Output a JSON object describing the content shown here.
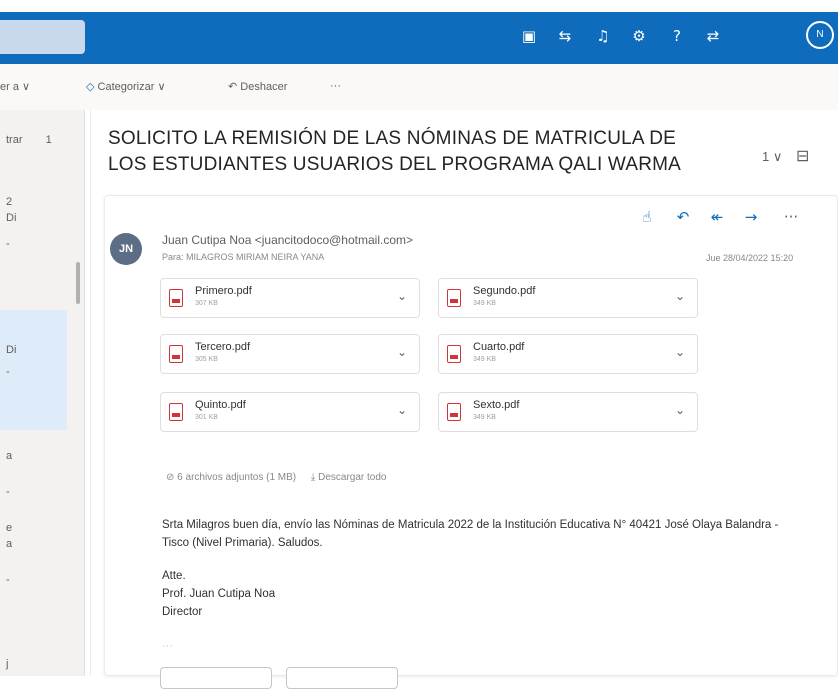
{
  "topbar": {
    "icons": [
      "outlook-icon",
      "teams-icon",
      "bell-icon",
      "gear-icon",
      "help-icon",
      "feedback-icon"
    ],
    "avatar_initials": "N"
  },
  "command_bar": {
    "move_label": "er a",
    "categorize_label": "Categorizar",
    "undo_label": "Deshacer",
    "more_label": "···"
  },
  "left_list": {
    "filter_label": "trar",
    "filter_count": "1",
    "items": [
      "2",
      "Di",
      "-",
      "Di",
      "-",
      "a",
      "-",
      "e",
      "a",
      "-",
      "j"
    ]
  },
  "message": {
    "subject": "SOLICITO LA REMISIÓN DE LAS NÓMINAS DE MATRICULA DE LOS ESTUDIANTES USUARIOS DEL PROGRAMA QALI WARMA",
    "subject_actions": "1 ∨",
    "sender_initials": "JN",
    "from": "Juan Cutipa Noa <juancitodoco@hotmail.com>",
    "to": "Para: MILAGROS MIRIAM NEIRA YANA",
    "date": "Jue 28/04/2022 15:20",
    "attachments": [
      {
        "name": "Primero.pdf",
        "size": "307 KB"
      },
      {
        "name": "Segundo.pdf",
        "size": "349 KB"
      },
      {
        "name": "Tercero.pdf",
        "size": "305 KB"
      },
      {
        "name": "Cuarto.pdf",
        "size": "349 KB"
      },
      {
        "name": "Quinto.pdf",
        "size": "301 KB"
      },
      {
        "name": "Sexto.pdf",
        "size": "349 KB"
      }
    ],
    "attachments_summary": "6 archivos adjuntos (1 MB)",
    "download_all": "Descargar todo",
    "body": "Srta Milagros buen día, envío las Nóminas de Matricula 2022 de la Institución Educativa N° 40421 José Olaya Balandra - Tisco (Nivel Primaria). Saludos.",
    "sign_att": "Atte.",
    "sign_name": "Prof. Juan Cutipa Noa",
    "sign_role": "Director",
    "ellipsis": "···"
  },
  "colors": {
    "brand": "#0f6cbd",
    "selected": "#deecf9",
    "pdf": "#d13438"
  }
}
